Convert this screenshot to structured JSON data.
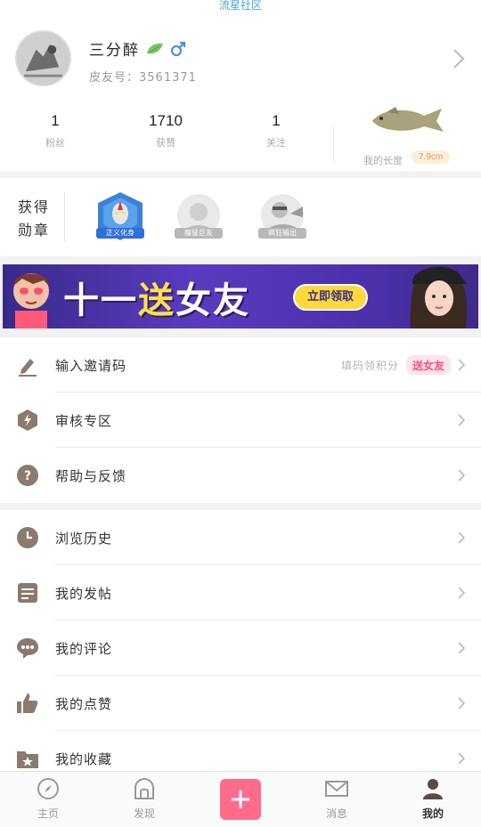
{
  "top": {
    "title": "流星社区"
  },
  "profile": {
    "username": "三分醉",
    "uid": "皮友号：3561371",
    "stats": [
      {
        "value": "1",
        "label": "粉丝"
      },
      {
        "value": "1710",
        "label": "获赞"
      },
      {
        "value": "1",
        "label": "关注"
      }
    ],
    "length": {
      "label": "我的长度",
      "value": "7.9cm"
    }
  },
  "badges": {
    "title": "获得勋章",
    "items": [
      {
        "caption": "正义化身",
        "color": "#2f6fd6"
      },
      {
        "caption": "瘦猛巨友",
        "color": "#b8b8b8"
      },
      {
        "caption": "疯狂输出",
        "color": "#b8b8b8"
      }
    ]
  },
  "banner": {
    "text_a": "十一",
    "text_b": "送",
    "text_c": "女友",
    "button": "立即领取"
  },
  "menu_group_1": [
    {
      "icon": "pen-icon",
      "label": "输入邀请码",
      "hint": "填码领积分"
    },
    {
      "icon": "lightning-shield-icon",
      "label": "审核专区"
    },
    {
      "icon": "question-circle-icon",
      "label": "帮助与反馈"
    }
  ],
  "menu_group_2": [
    {
      "icon": "clock-icon",
      "label": "浏览历史"
    },
    {
      "icon": "document-icon",
      "label": "我的发帖"
    },
    {
      "icon": "comment-bubble-icon",
      "label": "我的评论"
    },
    {
      "icon": "thumbs-up-icon",
      "label": "我的点赞"
    },
    {
      "icon": "star-folder-icon",
      "label": "我的收藏"
    }
  ],
  "tabs": [
    {
      "icon": "compass-icon",
      "label": "主页"
    },
    {
      "icon": "arch-icon",
      "label": "发现"
    },
    {
      "icon": "envelope-icon",
      "label": "消息"
    },
    {
      "icon": "person-icon",
      "label": "我的",
      "active": true
    }
  ],
  "colors": {
    "accent": "#ff6b8b",
    "icon": "#8a7b6e",
    "banner": "#4a2fa8"
  }
}
